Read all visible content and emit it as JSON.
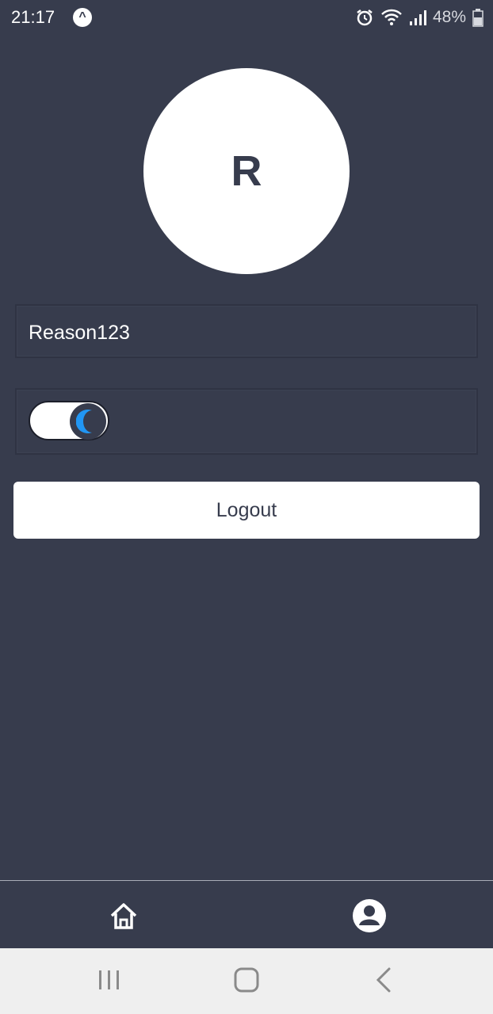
{
  "status_bar": {
    "time": "21:17",
    "app_icon_glyph": "^",
    "battery_text": "48%",
    "icons": [
      "alarm-icon",
      "wifi-icon",
      "signal-icon",
      "battery-icon"
    ]
  },
  "profile": {
    "initial": "R",
    "username": "Reason123",
    "dark_mode_enabled": true,
    "toggle_icon": "moon-icon"
  },
  "actions": {
    "logout_label": "Logout"
  },
  "bottom_nav": {
    "items": [
      "home-icon",
      "profile-icon"
    ]
  },
  "system_nav": {
    "items": [
      "recent-apps-icon",
      "home-button-icon",
      "back-icon"
    ]
  },
  "colors": {
    "background": "#373c4d",
    "surface": "#ffffff",
    "accent": "#2196f3",
    "system_nav_bg": "#efefef"
  }
}
